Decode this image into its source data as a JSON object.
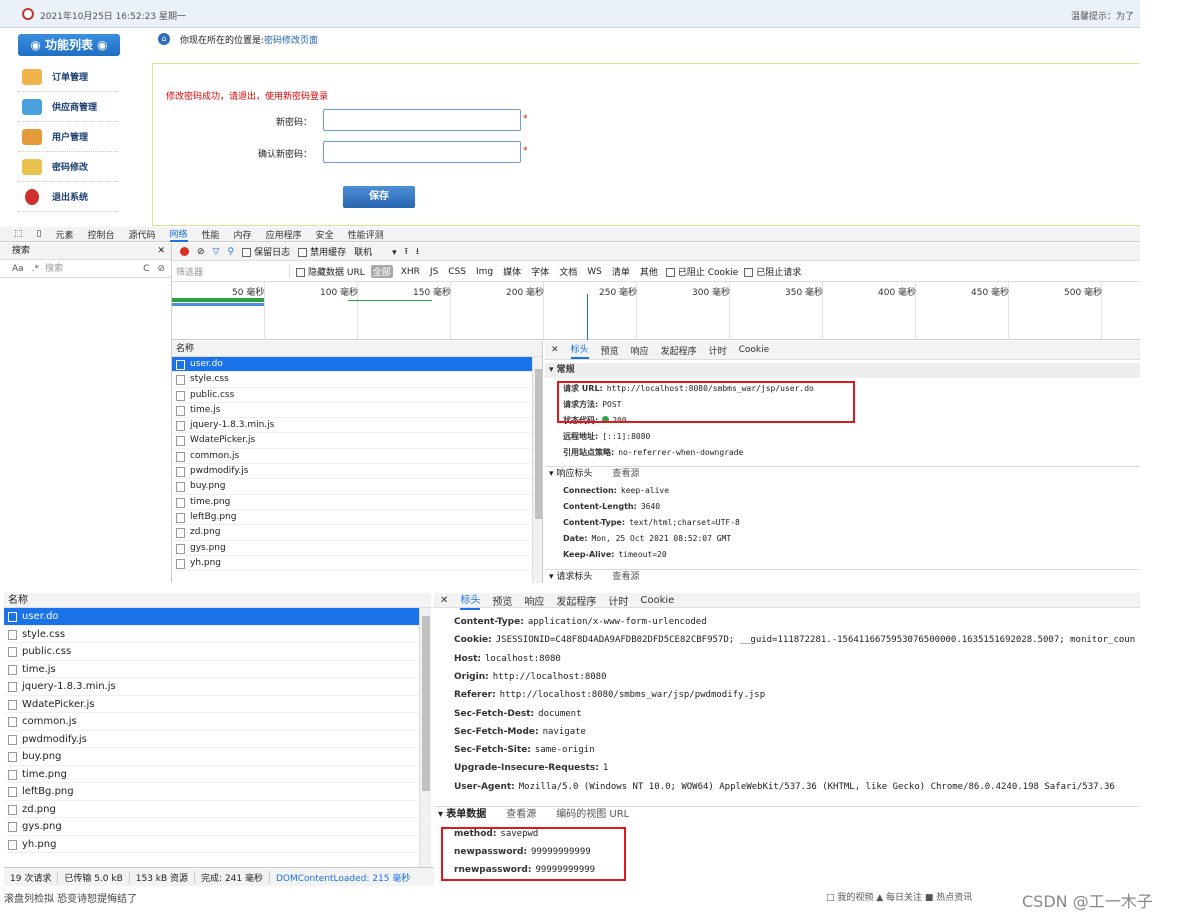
{
  "app": {
    "datetime": "2021年10月25日 16:52:23 星期一",
    "hint": "温馨提示：为了",
    "func_title": "功能列表",
    "nav": [
      {
        "label": "订单管理",
        "icon": "order-icon"
      },
      {
        "label": "供应商管理",
        "icon": "supplier-icon"
      },
      {
        "label": "用户管理",
        "icon": "users-icon"
      },
      {
        "label": "密码修改",
        "icon": "password-icon"
      },
      {
        "label": "退出系统",
        "icon": "exit-icon"
      }
    ],
    "crumb_prefix": "你现在所在的位置是:",
    "crumb_current": "密码修改页面",
    "message": "修改密码成功，请退出，使用新密码登录",
    "new_pwd_label": "新密码：",
    "confirm_pwd_label": "确认新密码：",
    "star": "*",
    "save_label": "保存"
  },
  "devtools": {
    "tabs": [
      "元素",
      "控制台",
      "源代码",
      "网络",
      "性能",
      "内存",
      "应用程序",
      "安全",
      "性能评测"
    ],
    "active_tab": "网络",
    "search_label": "搜索",
    "search_placeholder": "搜索",
    "search_aa": "Aa",
    "search_regex": ".*",
    "preserve_log": "保留日志",
    "disable_cache": "禁用缓存",
    "throttle": "联机",
    "filter_placeholder": "筛选器",
    "hide_data_urls": "隐藏数据 URL",
    "filter_types": [
      "全部",
      "XHR",
      "JS",
      "CSS",
      "Img",
      "媒体",
      "字体",
      "文档",
      "WS",
      "清单",
      "其他"
    ],
    "blocked_cookies": "已阻止 Cookie",
    "blocked_requests": "已阻止请求",
    "timeline_ticks": [
      "50 毫秒",
      "100 毫秒",
      "150 毫秒",
      "200 毫秒",
      "250 毫秒",
      "300 毫秒",
      "350 毫秒",
      "400 毫秒",
      "450 毫秒",
      "500 毫秒"
    ],
    "list_header": "名称",
    "requests": [
      "user.do",
      "style.css",
      "public.css",
      "time.js",
      "jquery-1.8.3.min.js",
      "WdatePicker.js",
      "common.js",
      "pwdmodify.js",
      "buy.png",
      "time.png",
      "leftBg.png",
      "zd.png",
      "gys.png",
      "yh.png"
    ],
    "detail_tabs": [
      "标头",
      "预览",
      "响应",
      "发起程序",
      "计时",
      "Cookie"
    ],
    "general_title": "常规",
    "general": [
      {
        "k": "请求 URL:",
        "v": "http://localhost:8080/smbms_war/jsp/user.do"
      },
      {
        "k": "请求方法:",
        "v": "POST"
      },
      {
        "k": "状态代码:",
        "v": "200"
      },
      {
        "k": "远程地址:",
        "v": "[::1]:8080"
      },
      {
        "k": "引用站点策略:",
        "v": "no-referrer-when-downgrade"
      }
    ],
    "resp_title": "响应标头",
    "view_source": "查看源",
    "resp_headers": [
      {
        "k": "Connection:",
        "v": "keep-alive"
      },
      {
        "k": "Content-Length:",
        "v": "3640"
      },
      {
        "k": "Content-Type:",
        "v": "text/html;charset=UTF-8"
      },
      {
        "k": "Date:",
        "v": "Mon, 25 Oct 2021 08:52:07 GMT"
      },
      {
        "k": "Keep-Alive:",
        "v": "timeout=20"
      }
    ],
    "req_title": "请求标头"
  },
  "devtools2": {
    "req_headers": [
      {
        "k": "Content-Type:",
        "v": "application/x-www-form-urlencoded"
      },
      {
        "k": "Cookie:",
        "v": "JSESSIONID=C48F8D4ADA9AFDB02DFD5CE82CBF957D; __guid=111872281.-1564116675953076500000.1635151692028.5007; monitor_coun"
      },
      {
        "k": "Host:",
        "v": "localhost:8080"
      },
      {
        "k": "Origin:",
        "v": "http://localhost:8080"
      },
      {
        "k": "Referer:",
        "v": "http://localhost:8080/smbms_war/jsp/pwdmodify.jsp"
      },
      {
        "k": "Sec-Fetch-Dest:",
        "v": "document"
      },
      {
        "k": "Sec-Fetch-Mode:",
        "v": "navigate"
      },
      {
        "k": "Sec-Fetch-Site:",
        "v": "same-origin"
      },
      {
        "k": "Upgrade-Insecure-Requests:",
        "v": "1"
      },
      {
        "k": "User-Agent:",
        "v": "Mozilla/5.0 (Windows NT 10.0; WOW64) AppleWebKit/537.36 (KHTML, like Gecko) Chrome/86.0.4240.198 Safari/537.36"
      }
    ],
    "form_title": "表单数据",
    "view_source": "查看源",
    "view_decoded": "编码的视图 URL",
    "form_data": [
      {
        "k": "method:",
        "v": "savepwd"
      },
      {
        "k": "newpassword:",
        "v": "99999999999"
      },
      {
        "k": "rnewpassword:",
        "v": "99999999999"
      }
    ],
    "status": {
      "requests": "19 次请求",
      "transferred": "已传输 5.0 kB",
      "resources": "153 kB 资源",
      "finish": "完成: 241 毫秒",
      "dcl": "DOMContentLoaded: 215 毫秒"
    },
    "cut_text": "滚盘列检拟  恐变诗恕提悔结了",
    "bottom_icons": "□ 我的视频  ▲ 每日关注  ■ 热点资讯",
    "watermark": "CSDN @工一木子"
  },
  "colors": {
    "accent": "#1a73e8",
    "highlight_box": "#e3171b",
    "brand_blue": "#1f6fc4",
    "error_red": "#e00000"
  }
}
